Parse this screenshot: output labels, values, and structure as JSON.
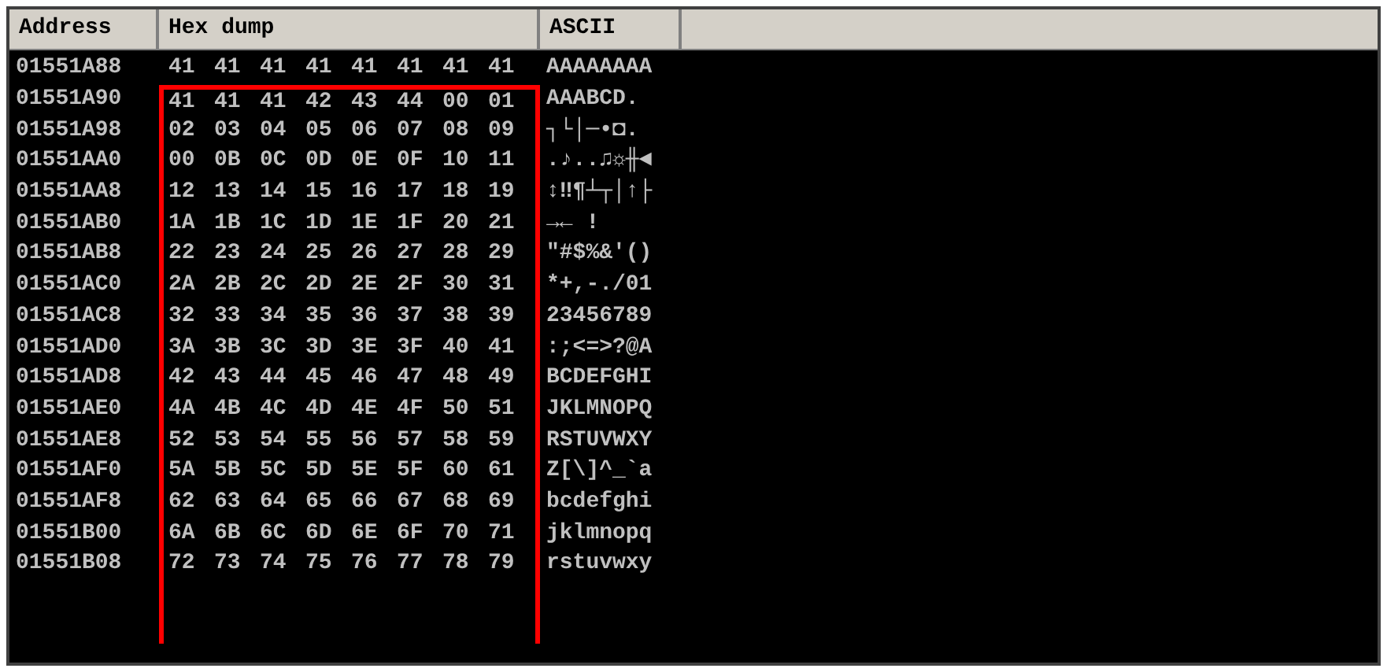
{
  "columns": [
    "Address",
    "Hex dump",
    "ASCII"
  ],
  "rows": [
    {
      "address": "01551A88",
      "hex": [
        "41",
        "41",
        "41",
        "41",
        "41",
        "41",
        "41",
        "41"
      ],
      "ascii": "AAAAAAAA",
      "highlighted": false
    },
    {
      "address": "01551A90",
      "hex": [
        "41",
        "41",
        "41",
        "42",
        "43",
        "44",
        "00",
        "01"
      ],
      "ascii": "AAABCD.",
      "highlighted": true
    },
    {
      "address": "01551A98",
      "hex": [
        "02",
        "03",
        "04",
        "05",
        "06",
        "07",
        "08",
        "09"
      ],
      "ascii": "┐└│─•◘.",
      "highlighted": true
    },
    {
      "address": "01551AA0",
      "hex": [
        "00",
        "0B",
        "0C",
        "0D",
        "0E",
        "0F",
        "10",
        "11"
      ],
      "ascii": ".♪..♫☼╫◄",
      "highlighted": true
    },
    {
      "address": "01551AA8",
      "hex": [
        "12",
        "13",
        "14",
        "15",
        "16",
        "17",
        "18",
        "19"
      ],
      "ascii": "↕‼¶┴┬│↑├",
      "highlighted": true
    },
    {
      "address": "01551AB0",
      "hex": [
        "1A",
        "1B",
        "1C",
        "1D",
        "1E",
        "1F",
        "20",
        "21"
      ],
      "ascii": "→← !",
      "highlighted": true
    },
    {
      "address": "01551AB8",
      "hex": [
        "22",
        "23",
        "24",
        "25",
        "26",
        "27",
        "28",
        "29"
      ],
      "ascii": "\"#$%&'()",
      "highlighted": true
    },
    {
      "address": "01551AC0",
      "hex": [
        "2A",
        "2B",
        "2C",
        "2D",
        "2E",
        "2F",
        "30",
        "31"
      ],
      "ascii": "*+,-./01",
      "highlighted": true
    },
    {
      "address": "01551AC8",
      "hex": [
        "32",
        "33",
        "34",
        "35",
        "36",
        "37",
        "38",
        "39"
      ],
      "ascii": "23456789",
      "highlighted": true
    },
    {
      "address": "01551AD0",
      "hex": [
        "3A",
        "3B",
        "3C",
        "3D",
        "3E",
        "3F",
        "40",
        "41"
      ],
      "ascii": ":;<=>?@A",
      "highlighted": true
    },
    {
      "address": "01551AD8",
      "hex": [
        "42",
        "43",
        "44",
        "45",
        "46",
        "47",
        "48",
        "49"
      ],
      "ascii": "BCDEFGHI",
      "highlighted": true
    },
    {
      "address": "01551AE0",
      "hex": [
        "4A",
        "4B",
        "4C",
        "4D",
        "4E",
        "4F",
        "50",
        "51"
      ],
      "ascii": "JKLMNOPQ",
      "highlighted": true
    },
    {
      "address": "01551AE8",
      "hex": [
        "52",
        "53",
        "54",
        "55",
        "56",
        "57",
        "58",
        "59"
      ],
      "ascii": "RSTUVWXY",
      "highlighted": true
    },
    {
      "address": "01551AF0",
      "hex": [
        "5A",
        "5B",
        "5C",
        "5D",
        "5E",
        "5F",
        "60",
        "61"
      ],
      "ascii": "Z[\\]^_`a",
      "highlighted": true
    },
    {
      "address": "01551AF8",
      "hex": [
        "62",
        "63",
        "64",
        "65",
        "66",
        "67",
        "68",
        "69"
      ],
      "ascii": "bcdefghi",
      "highlighted": true
    },
    {
      "address": "01551B00",
      "hex": [
        "6A",
        "6B",
        "6C",
        "6D",
        "6E",
        "6F",
        "70",
        "71"
      ],
      "ascii": "jklmnopq",
      "highlighted": true
    },
    {
      "address": "01551B08",
      "hex": [
        "72",
        "73",
        "74",
        "75",
        "76",
        "77",
        "78",
        "79"
      ],
      "ascii": "rstuvwxy",
      "highlighted": true
    }
  ]
}
